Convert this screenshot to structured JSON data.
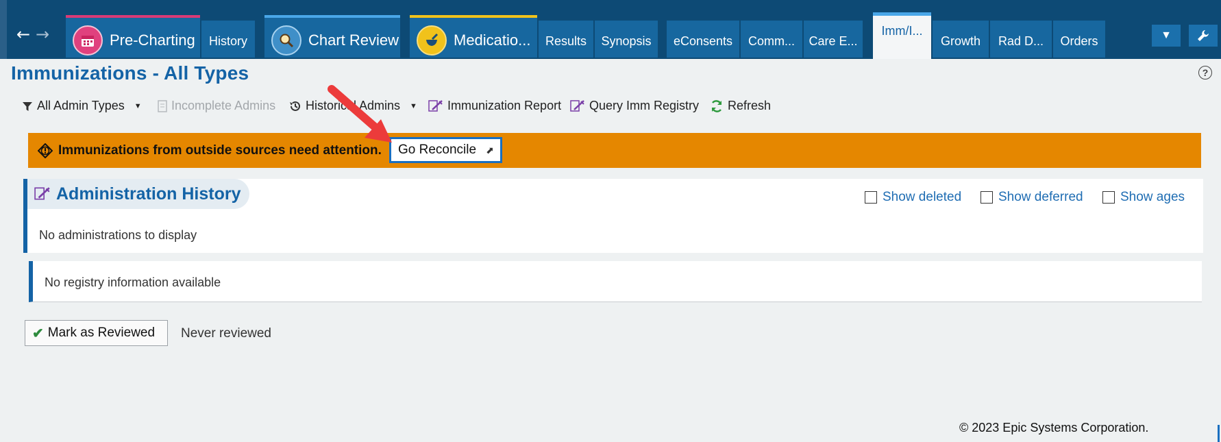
{
  "tabs": {
    "pre_charting": "Pre-Charting",
    "history": "History",
    "chart_review": "Chart Review",
    "medications": "Medicatio...",
    "results": "Results",
    "synopsis": "Synopsis",
    "econsents": "eConsents",
    "comm": "Comm...",
    "care_e": "Care E...",
    "imm": "Imm/I...",
    "growth": "Growth",
    "rad_d": "Rad D...",
    "orders": "Orders"
  },
  "page": {
    "title": "Immunizations - All Types"
  },
  "toolbar": {
    "all_admin_types": "All Admin Types",
    "incomplete_admins": "Incomplete Admins",
    "historical_admins": "Historical Admins",
    "immunization_report": "Immunization Report",
    "query_imm_registry": "Query Imm Registry",
    "refresh": "Refresh"
  },
  "alert": {
    "message": "Immunizations from outside sources need attention.",
    "button": "Go Reconcile"
  },
  "admin_history": {
    "title": "Administration History",
    "show_deleted": "Show deleted",
    "show_deferred": "Show deferred",
    "show_ages": "Show ages",
    "empty": "No administrations to display"
  },
  "registry": {
    "empty": "No registry information available"
  },
  "review": {
    "button": "Mark as Reviewed",
    "status": "Never reviewed"
  },
  "footer": {
    "copyright": "© 2023 Epic Systems Corporation."
  },
  "colors": {
    "topbar": "#0d4a75",
    "tab": "#17679f",
    "title_blue": "#1463a6",
    "alert_orange": "#e58700",
    "annotation_red": "#ec3b3b"
  },
  "icons": [
    "back-arrow-icon",
    "forward-arrow-icon",
    "calendar-icon",
    "magnifier-icon",
    "mortar-pestle-icon",
    "dropdown-icon",
    "wrench-icon",
    "help-icon",
    "filter-icon",
    "document-icon",
    "history-clock-icon",
    "syringe-icon",
    "refresh-icon",
    "warning-icon",
    "external-link-icon",
    "checkmark-icon"
  ]
}
